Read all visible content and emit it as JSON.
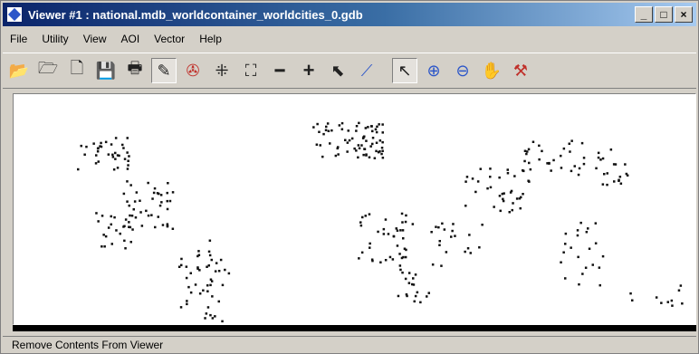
{
  "window": {
    "title": "Viewer #1 : national.mdb_worldcontainer_worldcities_0.gdb"
  },
  "titlebar": {
    "minimize": "_",
    "maximize": "□",
    "close": "×"
  },
  "menu": [
    "File",
    "Utility",
    "View",
    "AOI",
    "Vector",
    "Help"
  ],
  "toolbar": {
    "tools": [
      {
        "name": "open-icon",
        "glyph": "📂"
      },
      {
        "name": "open-layer-icon",
        "glyph": "🗁"
      },
      {
        "name": "new-icon",
        "glyph": "🗋"
      },
      {
        "name": "save-icon",
        "glyph": "💾"
      },
      {
        "name": "print-icon",
        "glyph": "🖶"
      },
      {
        "name": "remove-contents-icon",
        "glyph": "✎"
      },
      {
        "name": "rotate-icon",
        "glyph": "✇"
      },
      {
        "name": "fit-icon",
        "glyph": "⁜"
      },
      {
        "name": "zoom-extent-icon",
        "glyph": "⛶"
      },
      {
        "name": "horizontal-line-icon",
        "glyph": "━"
      },
      {
        "name": "crosshair-icon",
        "glyph": "+"
      },
      {
        "name": "arrow-icon",
        "glyph": "⬉"
      },
      {
        "name": "profile-icon",
        "glyph": "⟋"
      },
      {
        "name": "select-icon",
        "glyph": "↖"
      },
      {
        "name": "zoom-in-icon",
        "glyph": "⊕"
      },
      {
        "name": "zoom-out-icon",
        "glyph": "⊖"
      },
      {
        "name": "pan-icon",
        "glyph": "✋"
      },
      {
        "name": "inquire-icon",
        "glyph": "⚒"
      }
    ]
  },
  "status": {
    "text": "Remove Contents From Viewer"
  }
}
